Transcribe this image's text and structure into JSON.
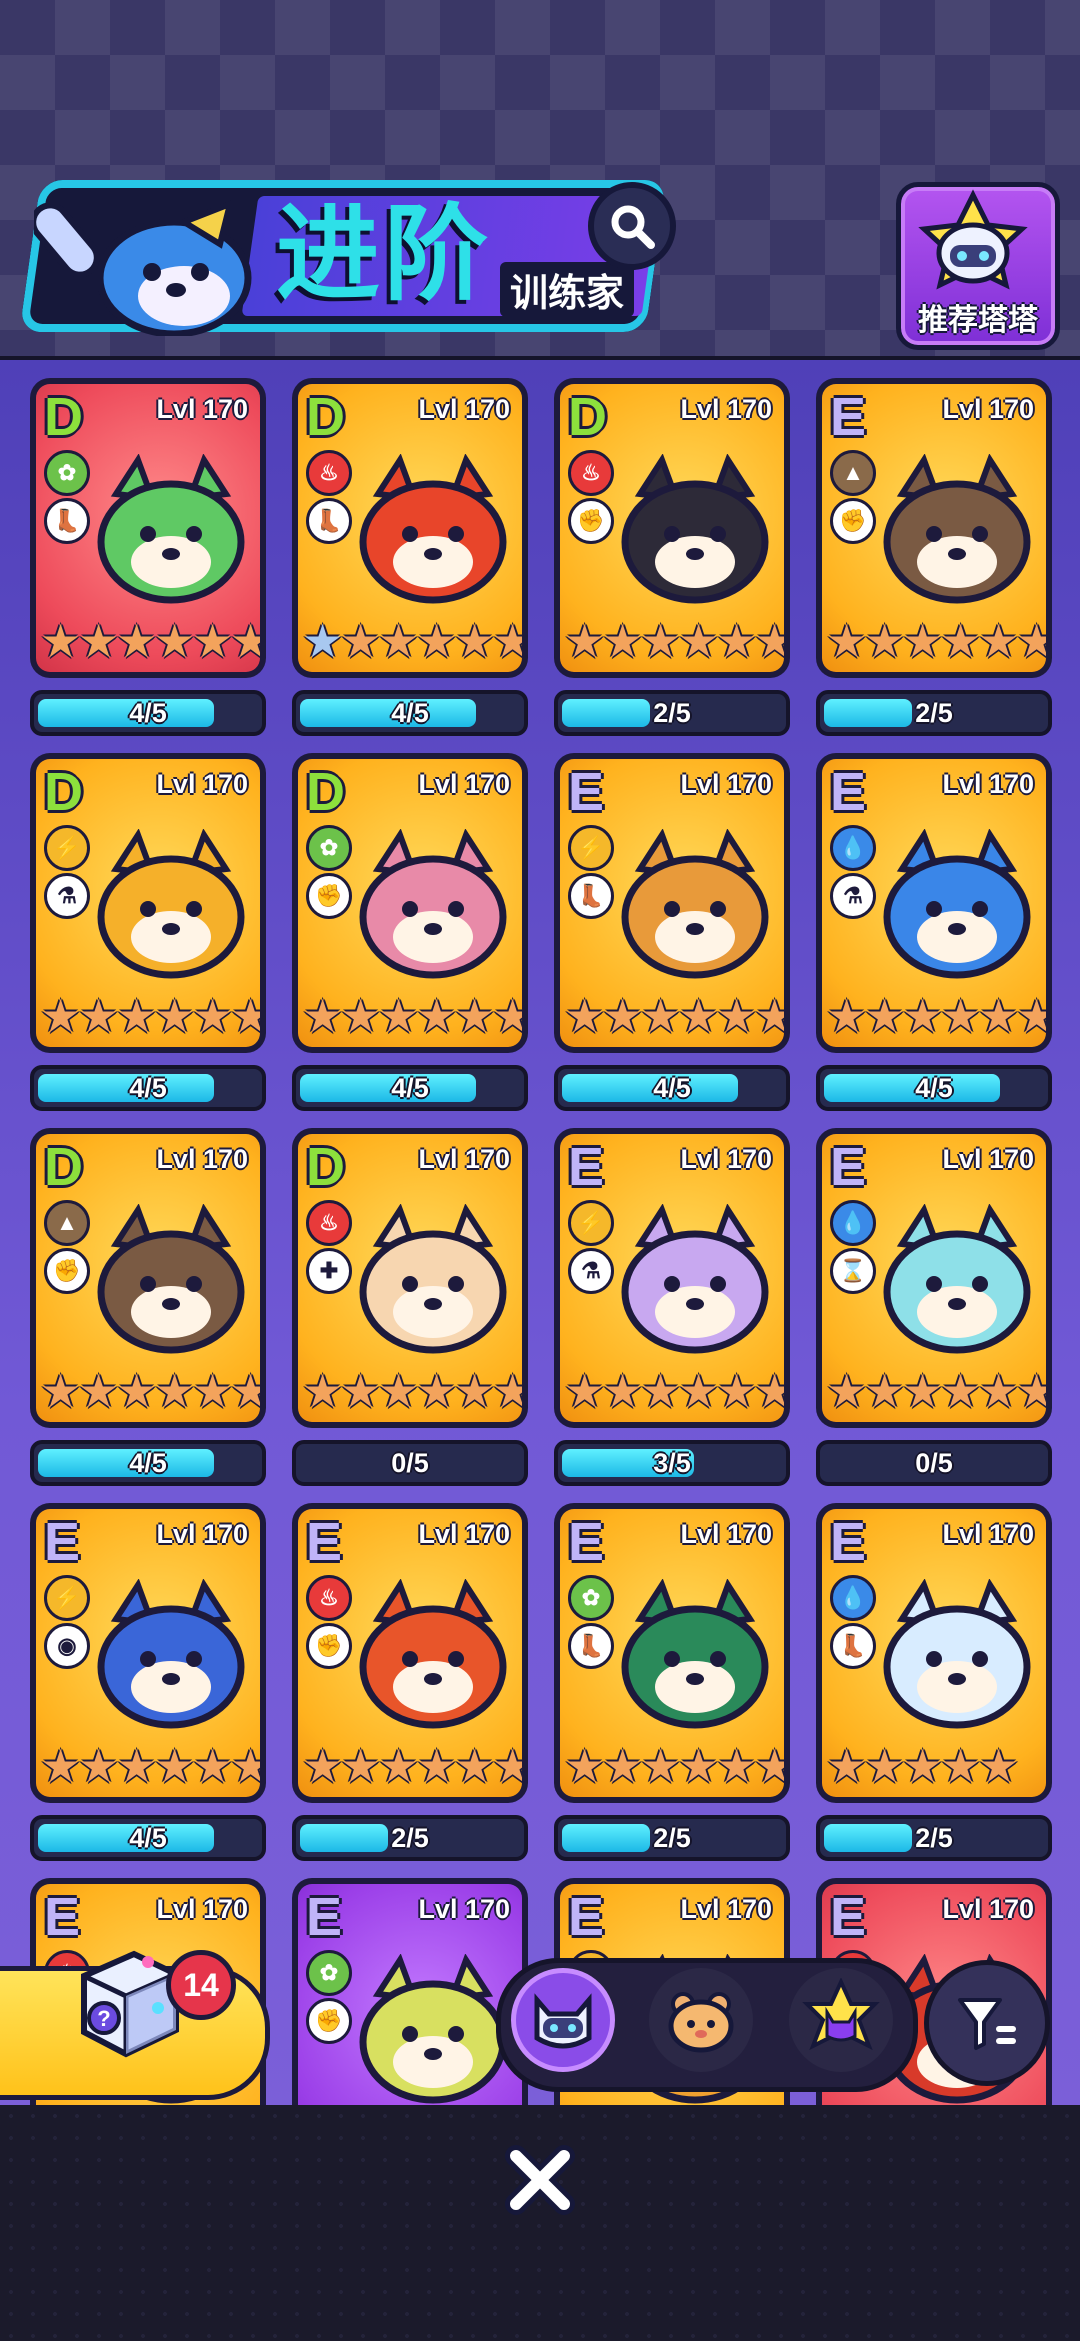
{
  "header": {
    "title_main": "进阶",
    "title_sub": "训练家",
    "search_icon": "magnifier-icon",
    "recommend_label": "推荐塔塔"
  },
  "cards": [
    {
      "tier": "D",
      "level": "Lvl 170",
      "element": "grass",
      "role": "boot",
      "bg": "red",
      "stars": 6,
      "blue_stars": 0,
      "progress_text": "4/5",
      "progress": 0.8,
      "creature": "green-frog",
      "color": "#5fc964"
    },
    {
      "tier": "D",
      "level": "Lvl 170",
      "element": "fire",
      "role": "boot",
      "bg": "gold",
      "stars": 6,
      "blue_stars": 1,
      "progress_text": "4/5",
      "progress": 0.8,
      "creature": "red-fox",
      "color": "#e8452a"
    },
    {
      "tier": "D",
      "level": "Lvl 170",
      "element": "fire",
      "role": "fist",
      "bg": "gold",
      "stars": 6,
      "blue_stars": 0,
      "progress_text": "2/5",
      "progress": 0.4,
      "creature": "black-pup",
      "color": "#2d2a38"
    },
    {
      "tier": "E",
      "level": "Lvl 170",
      "element": "rock",
      "role": "fist",
      "bg": "gold",
      "stars": 6,
      "blue_stars": 0,
      "progress_text": "2/5",
      "progress": 0.4,
      "creature": "brown-dino",
      "color": "#7a5a43"
    },
    {
      "tier": "D",
      "level": "Lvl 170",
      "element": "electric",
      "role": "flask",
      "bg": "gold",
      "stars": 6,
      "blue_stars": 0,
      "progress_text": "4/5",
      "progress": 0.8,
      "creature": "yellow-lion",
      "color": "#f5b02a"
    },
    {
      "tier": "D",
      "level": "Lvl 170",
      "element": "grass",
      "role": "fist",
      "bg": "gold",
      "stars": 6,
      "blue_stars": 0,
      "progress_text": "4/5",
      "progress": 0.8,
      "creature": "pink-mantis",
      "color": "#e88aa8"
    },
    {
      "tier": "E",
      "level": "Lvl 170",
      "element": "electric",
      "role": "boot",
      "bg": "gold",
      "stars": 6,
      "blue_stars": 0,
      "progress_text": "4/5",
      "progress": 0.8,
      "creature": "corgi",
      "color": "#e89a3a"
    },
    {
      "tier": "E",
      "level": "Lvl 170",
      "element": "water",
      "role": "flask",
      "bg": "gold",
      "stars": 6,
      "blue_stars": 0,
      "progress_text": "4/5",
      "progress": 0.8,
      "creature": "blue-mermaid",
      "color": "#3a86e8"
    },
    {
      "tier": "D",
      "level": "Lvl 170",
      "element": "rock",
      "role": "fist",
      "bg": "gold",
      "stars": 6,
      "blue_stars": 0,
      "progress_text": "4/5",
      "progress": 0.8,
      "creature": "ferret",
      "color": "#7a5a43"
    },
    {
      "tier": "D",
      "level": "Lvl 170",
      "element": "fire",
      "role": "cross",
      "bg": "gold",
      "stars": 6,
      "blue_stars": 0,
      "progress_text": "0/5",
      "progress": 0,
      "creature": "bunny",
      "color": "#f7d6b0"
    },
    {
      "tier": "E",
      "level": "Lvl 170",
      "element": "electric",
      "role": "flask",
      "bg": "gold",
      "stars": 6,
      "blue_stars": 0,
      "progress_text": "3/5",
      "progress": 0.6,
      "creature": "lilac-cat",
      "color": "#c8a8f0"
    },
    {
      "tier": "E",
      "level": "Lvl 170",
      "element": "water",
      "role": "hourglass",
      "bg": "gold",
      "stars": 6,
      "blue_stars": 0,
      "progress_text": "0/5",
      "progress": 0,
      "creature": "teal-axolotl",
      "color": "#8ee0e8"
    },
    {
      "tier": "E",
      "level": "Lvl 170",
      "element": "electric",
      "role": "eye",
      "bg": "gold",
      "stars": 6,
      "blue_stars": 0,
      "progress_text": "4/5",
      "progress": 0.8,
      "creature": "blue-fox",
      "color": "#3a66d8"
    },
    {
      "tier": "E",
      "level": "Lvl 170",
      "element": "fire",
      "role": "fist",
      "bg": "gold",
      "stars": 6,
      "blue_stars": 0,
      "progress_text": "2/5",
      "progress": 0.4,
      "creature": "red-toad",
      "color": "#e8552a"
    },
    {
      "tier": "E",
      "level": "Lvl 170",
      "element": "grass",
      "role": "boot",
      "bg": "gold",
      "stars": 6,
      "blue_stars": 0,
      "progress_text": "2/5",
      "progress": 0.4,
      "creature": "dark-plant",
      "color": "#2a8a5a"
    },
    {
      "tier": "E",
      "level": "Lvl 170",
      "element": "water",
      "role": "boot",
      "bg": "gold",
      "stars": 5,
      "blue_stars": 0,
      "progress_text": "2/5",
      "progress": 0.4,
      "creature": "white-seal",
      "color": "#d8ecff"
    },
    {
      "tier": "E",
      "level": "Lvl 170",
      "element": "fire",
      "role": "fist",
      "bg": "gold",
      "stars": 0,
      "blue_stars": 0,
      "progress_text": "",
      "progress": 0,
      "creature": "partial",
      "color": "#f0a030"
    },
    {
      "tier": "E",
      "level": "Lvl 170",
      "element": "grass",
      "role": "fist",
      "bg": "purple",
      "stars": 0,
      "blue_stars": 0,
      "progress_text": "",
      "progress": 0,
      "creature": "yellow-birds",
      "color": "#d8e060"
    },
    {
      "tier": "E",
      "level": "Lvl 170",
      "element": "electric",
      "role": "fist",
      "bg": "gold",
      "stars": 0,
      "blue_stars": 0,
      "progress_text": "",
      "progress": 0,
      "creature": "partial",
      "color": "#f0a030"
    },
    {
      "tier": "E",
      "level": "Lvl 170",
      "element": "fire",
      "role": "fist",
      "bg": "red",
      "stars": 0,
      "blue_stars": 0,
      "progress_text": "",
      "progress": 0,
      "creature": "red-creature",
      "color": "#d83a2a"
    }
  ],
  "element_colors": {
    "grass": "#6cc24a",
    "fire": "#e83a3a",
    "rock": "#8a6a4a",
    "electric": "#f5b82a",
    "water": "#3a8ae8"
  },
  "role_glyphs": {
    "boot": "👢",
    "fist": "✊",
    "flask": "⚗",
    "cross": "✚",
    "hourglass": "⌛",
    "eye": "◉"
  },
  "gacha": {
    "badge_count": "14",
    "icon": "mystery-box-icon"
  },
  "filter_tabs": [
    {
      "name": "tata-robot-icon",
      "active": true
    },
    {
      "name": "hamster-icon",
      "active": false
    },
    {
      "name": "star-cat-icon",
      "active": false
    }
  ],
  "bottom": {
    "close_icon": "close-x-icon"
  }
}
